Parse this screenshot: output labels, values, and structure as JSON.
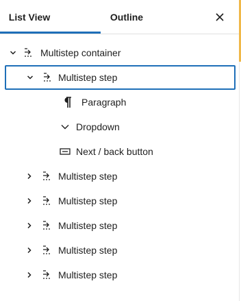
{
  "tabs": {
    "list_view": "List View",
    "outline": "Outline",
    "active": "list_view"
  },
  "close_icon": "close-icon",
  "colors": {
    "accent": "#1e6fb8",
    "scroll_accent": "#f0b849",
    "text": "#1e1e1e"
  },
  "tree": {
    "container": {
      "label": "Multistep container",
      "expanded": true,
      "icon": "multistep-icon"
    },
    "steps": [
      {
        "label": "Multistep step",
        "expanded": true,
        "selected": true,
        "icon": "multistep-icon",
        "children": [
          {
            "label": "Paragraph",
            "icon": "paragraph-icon"
          },
          {
            "label": "Dropdown",
            "icon": "dropdown-icon"
          },
          {
            "label": "Next / back button",
            "icon": "button-icon"
          }
        ]
      },
      {
        "label": "Multistep step",
        "expanded": false,
        "icon": "multistep-icon"
      },
      {
        "label": "Multistep step",
        "expanded": false,
        "icon": "multistep-icon"
      },
      {
        "label": "Multistep step",
        "expanded": false,
        "icon": "multistep-icon"
      },
      {
        "label": "Multistep step",
        "expanded": false,
        "icon": "multistep-icon"
      },
      {
        "label": "Multistep step",
        "expanded": false,
        "icon": "multistep-icon"
      }
    ]
  }
}
